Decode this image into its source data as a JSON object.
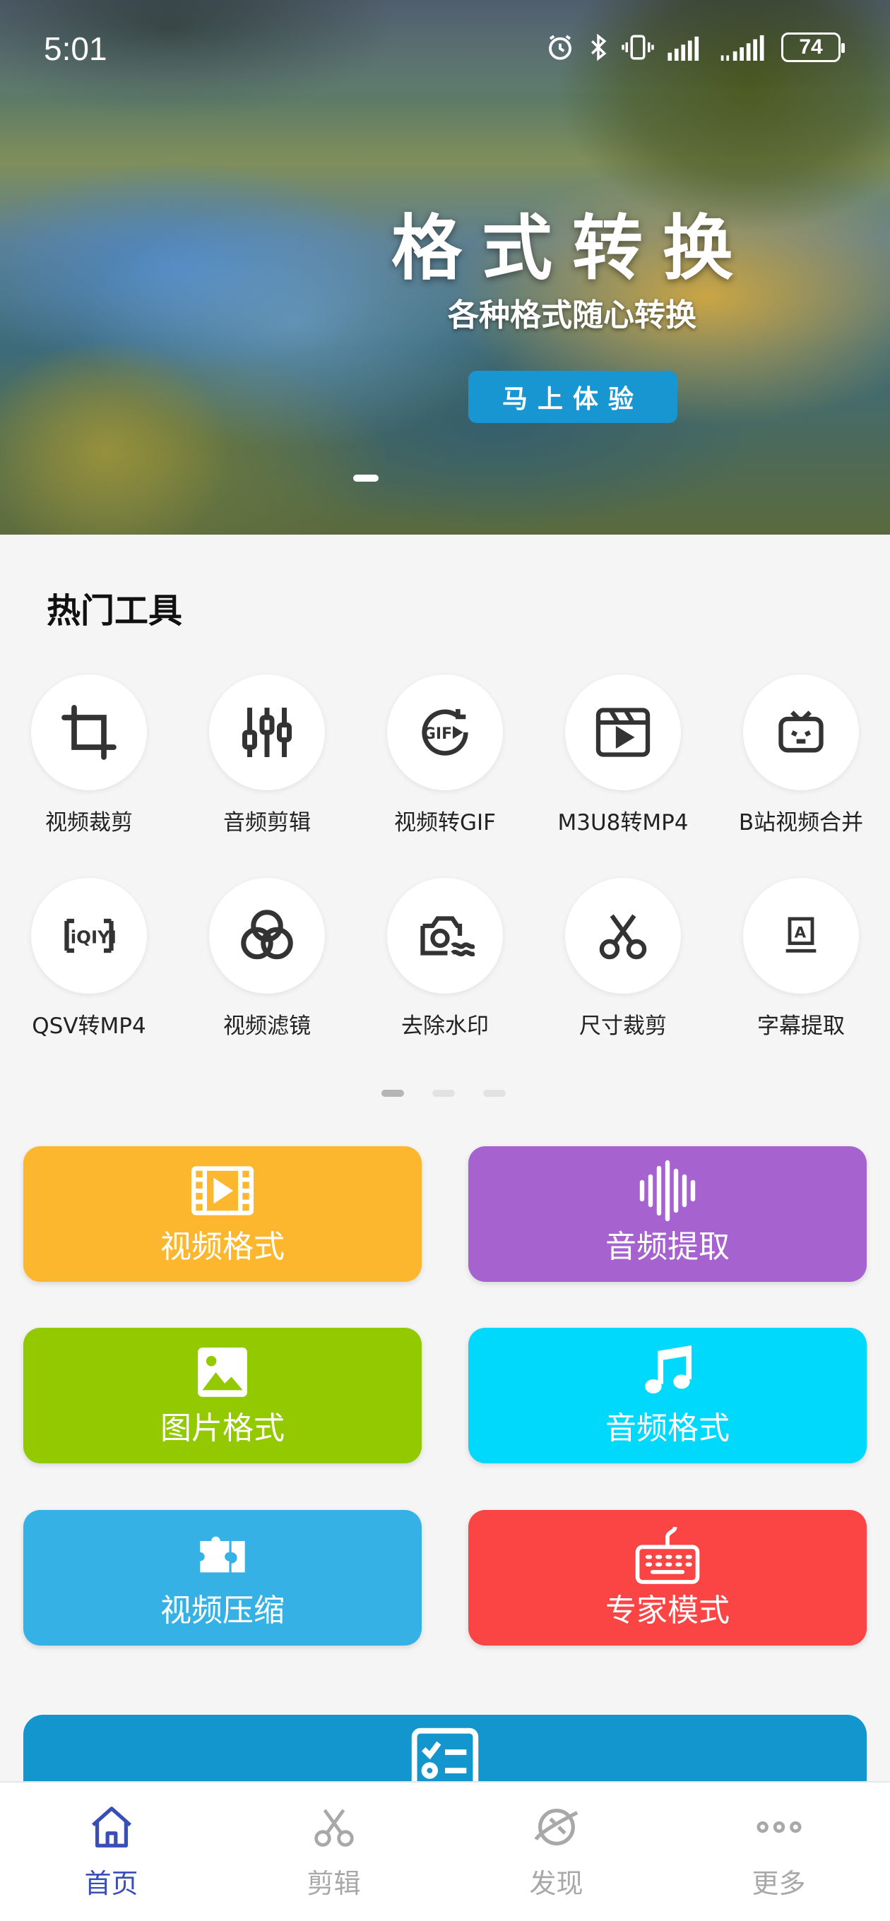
{
  "status_bar": {
    "time": "5:01",
    "battery": "74",
    "icons": [
      "alarm-icon",
      "bluetooth-icon",
      "vibrate-icon",
      "signal-icon",
      "signal-icon",
      "battery-icon"
    ]
  },
  "banner": {
    "title": "格式转换",
    "subtitle": "各种格式随心转换",
    "button_label": "马上体验",
    "accent_color": "#1796d2"
  },
  "hot_tools": {
    "title": "热门工具",
    "items": [
      {
        "label": "视频裁剪",
        "icon": "crop-icon"
      },
      {
        "label": "音频剪辑",
        "icon": "equalizer-icon"
      },
      {
        "label": "视频转GIF",
        "icon": "gif-icon"
      },
      {
        "label": "M3U8转MP4",
        "icon": "video-play-icon"
      },
      {
        "label": "B站视频合并",
        "icon": "bilibili-icon"
      },
      {
        "label": "QSV转MP4",
        "icon": "iqiyi-icon"
      },
      {
        "label": "视频滤镜",
        "icon": "filter-icon"
      },
      {
        "label": "去除水印",
        "icon": "watermark-icon"
      },
      {
        "label": "尺寸裁剪",
        "icon": "scissors-icon"
      },
      {
        "label": "字幕提取",
        "icon": "subtitle-icon"
      }
    ],
    "page_count": 3,
    "current_page": 1
  },
  "features": [
    {
      "label": "视频格式",
      "icon": "film-icon",
      "color": "#fdb72f"
    },
    {
      "label": "音频提取",
      "icon": "waveform-icon",
      "color": "#a662cf"
    },
    {
      "label": "图片格式",
      "icon": "image-icon",
      "color": "#93c900"
    },
    {
      "label": "音频格式",
      "icon": "music-note-icon",
      "color": "#00d9fc"
    },
    {
      "label": "视频压缩",
      "icon": "puzzle-icon",
      "color": "#35b1e6"
    },
    {
      "label": "专家模式",
      "icon": "keyboard-icon",
      "color": "#fb4545"
    }
  ],
  "partial_card": {
    "icon": "checklist-icon",
    "color": "#1296cd"
  },
  "bottom_nav": {
    "active_color": "#3a4fb6",
    "items": [
      {
        "label": "首页",
        "icon": "home-icon",
        "active": true
      },
      {
        "label": "剪辑",
        "icon": "scissors-icon",
        "active": false
      },
      {
        "label": "发现",
        "icon": "planet-icon",
        "active": false
      },
      {
        "label": "更多",
        "icon": "more-icon",
        "active": false
      }
    ]
  }
}
